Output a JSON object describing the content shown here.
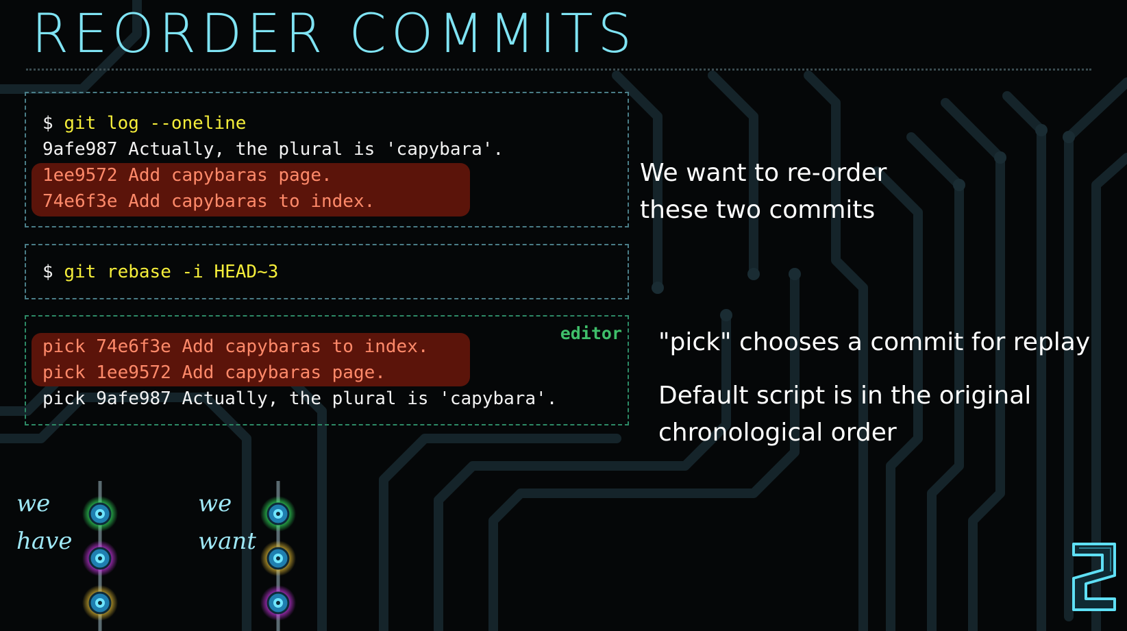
{
  "title": "REORDER COMMITS",
  "panel_log": {
    "prompt": "$ ",
    "command": "git log --oneline",
    "lines": [
      "9afe987 Actually, the plural is 'capybara'.",
      "1ee9572 Add capybaras page.",
      "74e6f3e Add capybaras to index."
    ]
  },
  "panel_rebase": {
    "prompt": "$ ",
    "command": "git rebase -i HEAD~3"
  },
  "panel_editor": {
    "label": "editor",
    "lines": [
      "pick 74e6f3e Add capybaras to index.",
      "pick 1ee9572 Add capybaras page.",
      "pick 9afe987 Actually, the plural is 'capybara'."
    ]
  },
  "notes": {
    "reorder_line1": "We want to re-order",
    "reorder_line2": "these two commits",
    "pick_note": "\"pick\" chooses a commit for replay",
    "default_line1": "Default script is in the original",
    "default_line2": "chronological order"
  },
  "graph_have": {
    "label1": "we",
    "label2": "have"
  },
  "graph_want": {
    "label1": "we",
    "label2": "want"
  },
  "colors": {
    "title": "#7fe3f3",
    "command": "#f5ee3a",
    "highlight": "#5b140a",
    "highlight_text": "#ff8a6a",
    "editor_label": "#3fbf6a",
    "glow_green": "#39ff6a",
    "glow_magenta": "#e23cff",
    "glow_yellow": "#ffd23a"
  },
  "icons": [
    "commit-node-icon",
    "logo-icon"
  ]
}
